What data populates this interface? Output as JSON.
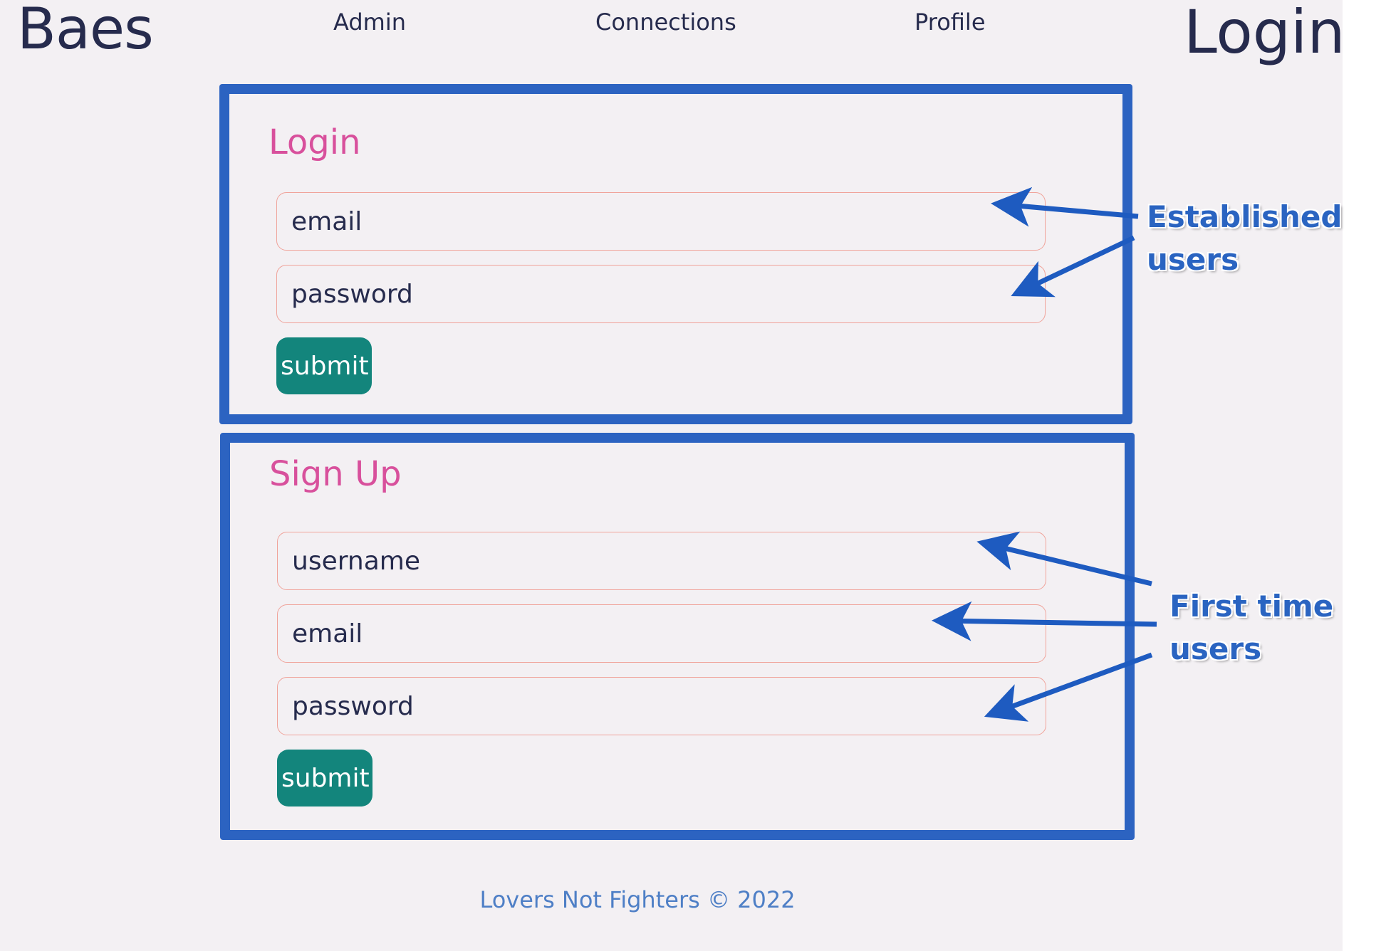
{
  "navbar": {
    "brand": "Baes",
    "links": [
      "Admin",
      "Connections",
      "Profile"
    ],
    "page_heading": "Login"
  },
  "login_form": {
    "title": "Login",
    "email_placeholder": "email",
    "password_placeholder": "password",
    "submit_label": "submit"
  },
  "signup_form": {
    "title": "Sign Up",
    "username_placeholder": "username",
    "email_placeholder": "email",
    "password_placeholder": "password",
    "submit_label": "submit"
  },
  "footer": {
    "text": "Lovers Not Fighters © 2022"
  },
  "annotations": {
    "established": [
      "Established",
      "users"
    ],
    "first_time": [
      "First time",
      "users"
    ]
  },
  "colors": {
    "background": "#f3f0f3",
    "text": "#262b4d",
    "card_border": "#2c63c1",
    "title": "#d8509c",
    "field_border": "#f0a39a",
    "button": "#13857c",
    "footer": "#4e7fc6",
    "annotation": "#2a64c1"
  }
}
